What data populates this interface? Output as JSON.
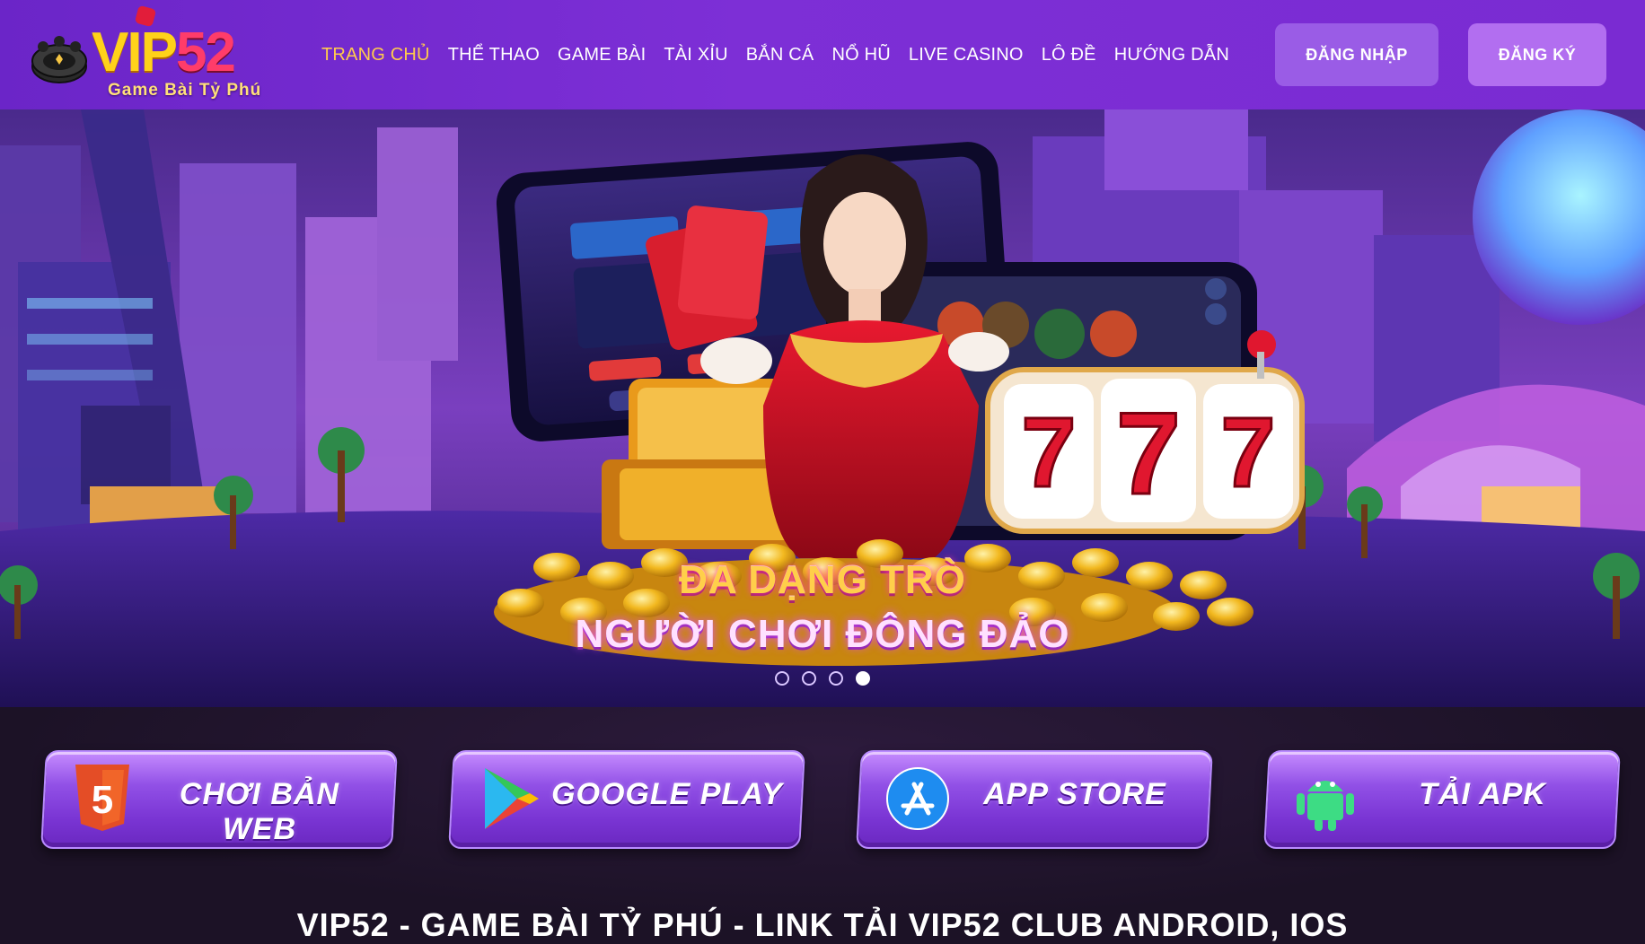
{
  "brand": {
    "logo_main": "VIP",
    "logo_number": "52",
    "tagline": "Game Bài Tỷ Phú"
  },
  "nav": {
    "items": [
      {
        "label": "TRANG CHỦ",
        "active": true
      },
      {
        "label": "THỂ THAO",
        "active": false
      },
      {
        "label": "GAME BÀI",
        "active": false
      },
      {
        "label": "TÀI XỈU",
        "active": false
      },
      {
        "label": "BẮN CÁ",
        "active": false
      },
      {
        "label": "NỔ HŨ",
        "active": false
      },
      {
        "label": "LIVE CASINO",
        "active": false
      },
      {
        "label": "LÔ ĐỀ",
        "active": false
      },
      {
        "label": "HƯỚNG DẪN",
        "active": false
      }
    ]
  },
  "auth": {
    "login_label": "ĐĂNG NHẬP",
    "register_label": "ĐĂNG KÝ"
  },
  "hero": {
    "line1": "ĐA DẠNG TRÒ",
    "line2": "NGƯỜI CHƠI ĐÔNG ĐẢO",
    "slides_total": 4,
    "active_slide": 4
  },
  "downloads": [
    {
      "label": "CHƠI BẢN WEB",
      "icon": "html5-icon"
    },
    {
      "label": "GOOGLE PLAY",
      "icon": "google-play-icon"
    },
    {
      "label": "APP STORE",
      "icon": "app-store-icon"
    },
    {
      "label": "TẢI APK",
      "icon": "android-icon"
    }
  ],
  "colors": {
    "header_bg": "#7a2bd2",
    "nav_active": "#ffca4d",
    "login_bg": "#9a5ce6",
    "register_bg": "#b26ef0",
    "page_bg": "#1c1226"
  },
  "section": {
    "heading": "VIP52 - GAME BÀI TỶ PHÚ - LINK TẢI VIP52 CLUB ANDROID, IOS"
  }
}
